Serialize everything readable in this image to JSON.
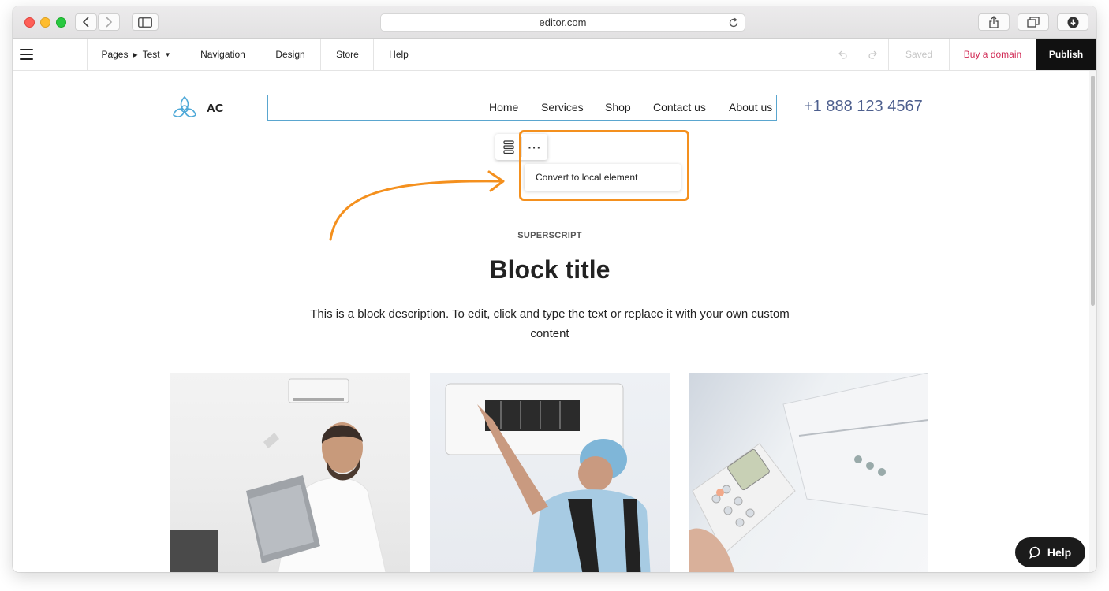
{
  "browser": {
    "url": "editor.com",
    "reload_icon": "reload-icon",
    "back_icon": "chevron-left-icon",
    "forward_icon": "chevron-right-icon",
    "sidebar_icon": "sidebar-icon",
    "share_icon": "share-icon",
    "tabs_icon": "tabs-icon",
    "download_icon": "download-icon"
  },
  "toolbar": {
    "menu_icon": "hamburger-icon",
    "pages_label": "Pages",
    "page_name": "Test",
    "navigation": "Navigation",
    "design": "Design",
    "store": "Store",
    "help": "Help",
    "saved": "Saved",
    "buy_domain": "Buy a domain",
    "publish": "Publish"
  },
  "site": {
    "logo_text": "AC",
    "nav": [
      "Home",
      "Services",
      "Shop",
      "Contact us",
      "About us"
    ],
    "phone": "+1 888 123 4567"
  },
  "element_menu": {
    "dots": "···",
    "convert_label": "Convert to local element"
  },
  "block": {
    "superscript": "SUPERSCRIPT",
    "title": "Block title",
    "description": "This is a block description. To edit, click and type the text or replace it with your own custom content"
  },
  "help_button": "Help",
  "colors": {
    "accent_orange": "#f4901e",
    "nav_outline": "#5aa6cf",
    "buy_domain": "#d12a55",
    "phone": "#4d5f8e"
  }
}
